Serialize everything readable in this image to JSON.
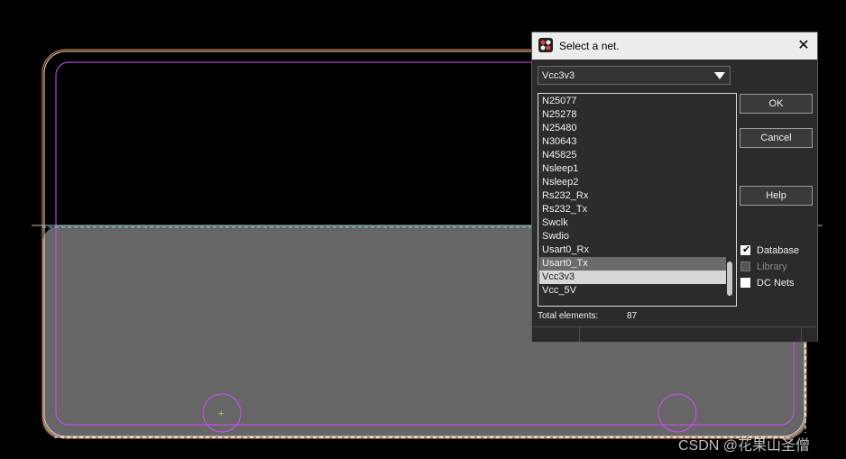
{
  "dialog": {
    "title": "Select a net.",
    "close_glyph": "✕",
    "icon": "app-icon",
    "combo_value": "Vcc3v3",
    "list_items": [
      "N25077",
      "N25278",
      "N25480",
      "N30643",
      "N45825",
      "Nsleep1",
      "Nsleep2",
      "Rs232_Rx",
      "Rs232_Tx",
      "Swclk",
      "Swdio",
      "Usart0_Rx",
      "Usart0_Tx",
      "Vcc3v3",
      "Vcc_5V"
    ],
    "selected_item": "Vcc3v3",
    "ok_label": "OK",
    "cancel_label": "Cancel",
    "help_label": "Help",
    "checkboxes": [
      {
        "label": "Database",
        "checked": true,
        "enabled": true
      },
      {
        "label": "Library",
        "checked": false,
        "enabled": false
      },
      {
        "label": "DC Nets",
        "checked": false,
        "enabled": true
      }
    ],
    "total_label": "Total elements:",
    "total_value": "87"
  },
  "watermark": "CSDN @花果山圣僧",
  "colors": {
    "board_fill": "#666666",
    "outline_orange": "#ff8c3a",
    "outline_magenta": "#d64bff",
    "dash_cyan": "#4fe0ff"
  }
}
